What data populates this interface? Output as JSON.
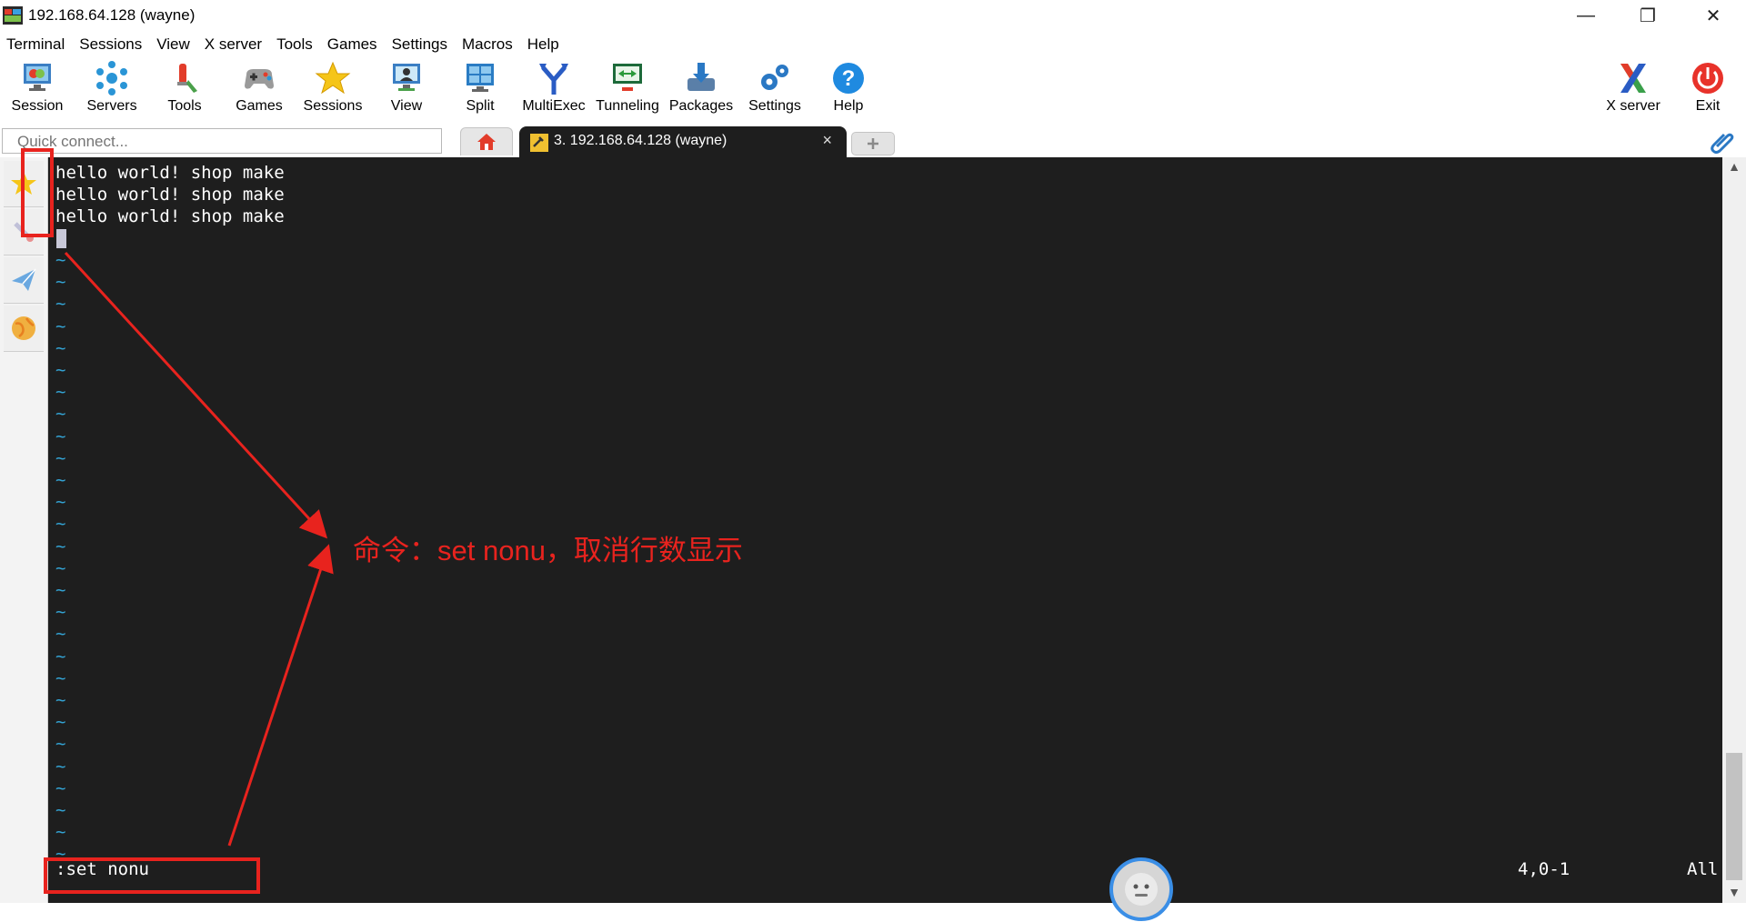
{
  "window": {
    "title": "192.168.64.128 (wayne)",
    "minimize": "—",
    "restore": "❐",
    "close": "✕"
  },
  "menu": [
    "Terminal",
    "Sessions",
    "View",
    "X server",
    "Tools",
    "Games",
    "Settings",
    "Macros",
    "Help"
  ],
  "toolbar": {
    "session": "Session",
    "servers": "Servers",
    "tools": "Tools",
    "games": "Games",
    "sessions": "Sessions",
    "view": "View",
    "split": "Split",
    "multiexec": "MultiExec",
    "tunneling": "Tunneling",
    "packages": "Packages",
    "settings": "Settings",
    "help": "Help",
    "xserver": "X server",
    "exit": "Exit"
  },
  "quick_connect": {
    "placeholder": "Quick connect..."
  },
  "tabs": {
    "active_label": "3. 192.168.64.128 (wayne)",
    "close": "×"
  },
  "terminal": {
    "lines": [
      "hello world! shop make",
      "hello world! shop make",
      "hello world! shop make"
    ],
    "tilde": "~",
    "command": ":set nonu",
    "position": "4,0-1",
    "scroll": "All"
  },
  "annotation": {
    "text": "命令：set nonu，取消行数显示"
  },
  "colors": {
    "accent_red": "#e8231e",
    "terminal_bg": "#1e1e1e",
    "tilde_blue": "#33a3d4"
  }
}
